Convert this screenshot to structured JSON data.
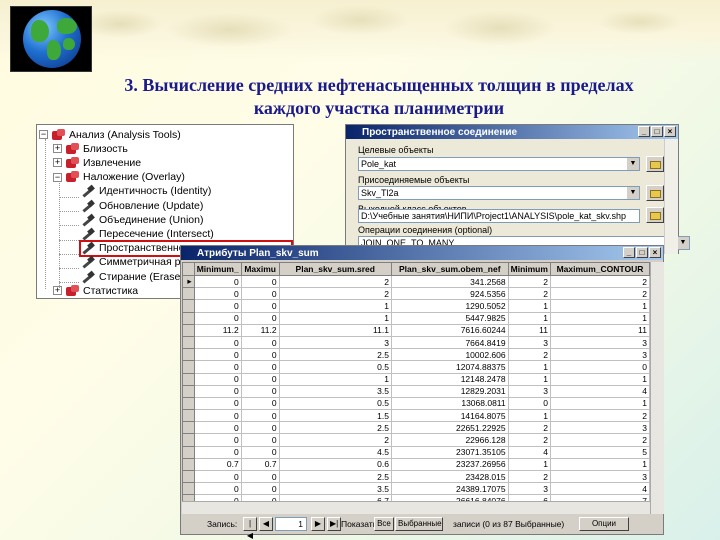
{
  "slide": {
    "title_line1": "3. Вычисление средних нефтенасыщенных толщин в пределах",
    "title_line2": "каждого участка планиметрии"
  },
  "tree": {
    "items": [
      {
        "label": "Анализ (Analysis Tools)",
        "kind": "toolbox",
        "expander": "−"
      },
      {
        "label": "Близость",
        "kind": "toolbox",
        "expander": "+"
      },
      {
        "label": "Извлечение",
        "kind": "toolbox",
        "expander": "+"
      },
      {
        "label": "Наложение (Overlay)",
        "kind": "toolbox",
        "expander": "−"
      },
      {
        "label": "Идентичность (Identity)",
        "kind": "tool"
      },
      {
        "label": "Обновление (Update)",
        "kind": "tool"
      },
      {
        "label": "Объединение (Union)",
        "kind": "tool"
      },
      {
        "label": "Пересечение (Intersect)",
        "kind": "tool"
      },
      {
        "label": "Пространственное соединение",
        "kind": "tool",
        "selected": true
      },
      {
        "label": "Симметричная разность",
        "kind": "tool"
      },
      {
        "label": "Стирание (Erase)",
        "kind": "tool"
      },
      {
        "label": "Статистика",
        "kind": "toolbox",
        "expander": "+"
      }
    ]
  },
  "join_dialog": {
    "title": "Пространственное соединение",
    "target_label": "Целевые объекты",
    "target_value": "Pole_kat",
    "join_label": "Присоединяемые объекты",
    "join_value": "Skv_Tl2a",
    "output_label": "Выходной класс объектов",
    "output_value": "D:\\Учебные занятия\\НИПИ\\Project1\\ANALYSIS\\pole_kat_skv.shp",
    "operation_label": "Операции соединения (optional)",
    "operation_value": "JOIN_ONE_TO_MANY"
  },
  "attr_table": {
    "title": "Атрибуты Plan_skv_sum",
    "columns": [
      "Minimum_",
      "Maximu",
      "Plan_skv_sum.sred",
      "Plan_skv_sum.obem_nef",
      "Minimum",
      "Maximum_CONTOUR"
    ],
    "rows": [
      [
        "0",
        "0",
        "2",
        "341.2568",
        "2",
        "2"
      ],
      [
        "0",
        "0",
        "2",
        "924.5356",
        "2",
        "2"
      ],
      [
        "0",
        "0",
        "1",
        "1290.5052",
        "1",
        "1"
      ],
      [
        "0",
        "0",
        "1",
        "5447.9825",
        "1",
        "1"
      ],
      [
        "11.2",
        "11.2",
        "11.1",
        "7616.60244",
        "11",
        "11"
      ],
      [
        "0",
        "0",
        "3",
        "7664.8419",
        "3",
        "3"
      ],
      [
        "0",
        "0",
        "2.5",
        "10002.606",
        "2",
        "3"
      ],
      [
        "0",
        "0",
        "0.5",
        "12074.88375",
        "1",
        "0"
      ],
      [
        "0",
        "0",
        "1",
        "12148.2478",
        "1",
        "1"
      ],
      [
        "0",
        "0",
        "3.5",
        "12829.2031",
        "3",
        "4"
      ],
      [
        "0",
        "0",
        "0.5",
        "13068.0811",
        "0",
        "1"
      ],
      [
        "0",
        "0",
        "1.5",
        "14164.8075",
        "1",
        "2"
      ],
      [
        "0",
        "0",
        "2.5",
        "22651.22925",
        "2",
        "3"
      ],
      [
        "0",
        "0",
        "2",
        "22966.128",
        "2",
        "2"
      ],
      [
        "0",
        "0",
        "4.5",
        "23071.35105",
        "4",
        "5"
      ],
      [
        "0.7",
        "0.7",
        "0.6",
        "23237.26956",
        "1",
        "1"
      ],
      [
        "0",
        "0",
        "2.5",
        "23428.015",
        "2",
        "3"
      ],
      [
        "0",
        "0",
        "3.5",
        "24389.17075",
        "3",
        "4"
      ],
      [
        "0",
        "0",
        "6.7",
        "26616.84076",
        "6",
        "7"
      ],
      [
        "0",
        "0",
        "5.5",
        "26719.32615",
        "5",
        "6"
      ]
    ],
    "nav": {
      "records_label": "Запись:",
      "current_record": "1",
      "show_label": "Показать:",
      "all_button": "Все",
      "selected_button": "Выбранные",
      "status": "записи (0 из 87 Выбранные)",
      "options_button": "Опции"
    }
  }
}
